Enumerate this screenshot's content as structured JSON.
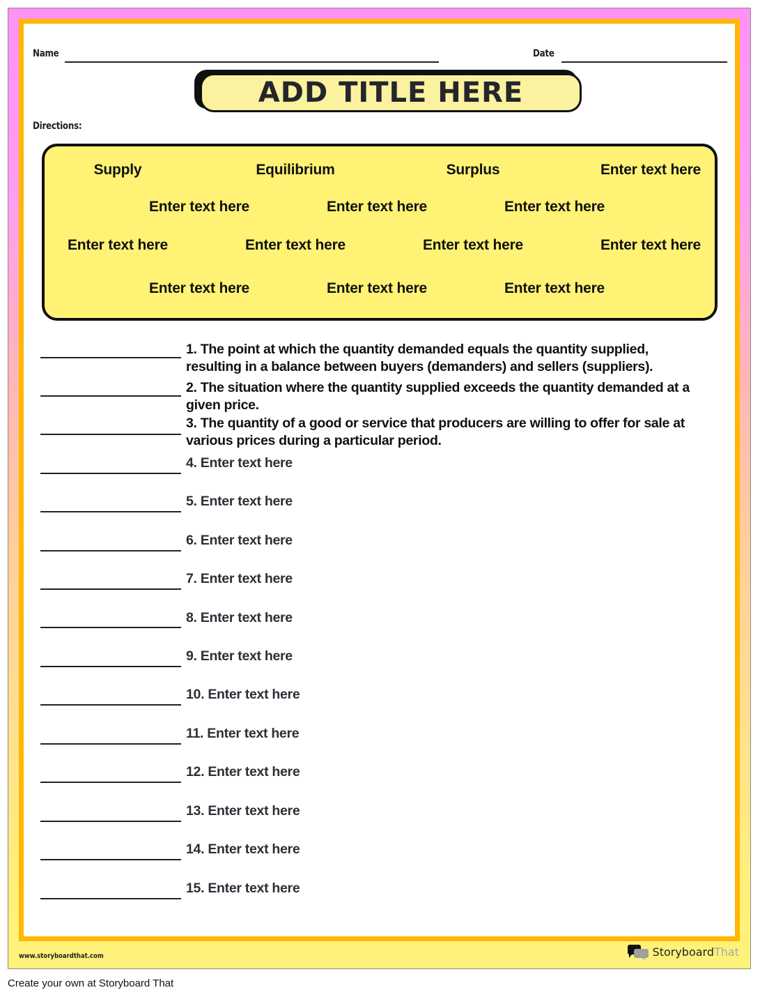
{
  "header": {
    "name_label": "Name",
    "date_label": "Date",
    "title": "ADD TITLE HERE",
    "directions_label": "Directions:"
  },
  "word_bank": {
    "rows": [
      [
        "Supply",
        "Equilibrium",
        "Surplus",
        "Enter text here"
      ],
      [
        "Enter text here",
        "Enter text here",
        "Enter text here"
      ],
      [
        "Enter text here",
        "Enter text here",
        "Enter text here",
        "Enter text here"
      ],
      [
        "Enter text here",
        "Enter text here",
        "Enter text here"
      ]
    ]
  },
  "questions": [
    {
      "number": "1.",
      "text": "The point at which the quantity demanded equals the quantity supplied, resulting in a balance between buyers (demanders) and sellers (suppliers).",
      "placeholder": false
    },
    {
      "number": "2.",
      "text": "The situation where the quantity supplied exceeds the quantity demanded at a given price.",
      "placeholder": false
    },
    {
      "number": "3.",
      "text": "The quantity of a good or service that producers are willing to offer for sale at various prices during a particular period.",
      "placeholder": false
    },
    {
      "number": "4.",
      "text": "Enter text here",
      "placeholder": true
    },
    {
      "number": "5.",
      "text": "Enter text here",
      "placeholder": true
    },
    {
      "number": "6.",
      "text": "Enter text here",
      "placeholder": true
    },
    {
      "number": "7.",
      "text": "Enter text here",
      "placeholder": true
    },
    {
      "number": "8.",
      "text": "Enter text here",
      "placeholder": true
    },
    {
      "number": "9.",
      "text": "Enter text here",
      "placeholder": true
    },
    {
      "number": "10.",
      "text": "Enter text here",
      "placeholder": true
    },
    {
      "number": "11.",
      "text": "Enter text here",
      "placeholder": true
    },
    {
      "number": "12.",
      "text": "Enter text here",
      "placeholder": true
    },
    {
      "number": "13.",
      "text": "Enter text here",
      "placeholder": true
    },
    {
      "number": "14.",
      "text": "Enter text here",
      "placeholder": true
    },
    {
      "number": "15.",
      "text": "Enter text here",
      "placeholder": true
    }
  ],
  "footer": {
    "url": "www.storyboardthat.com",
    "brand_bold": "Storyboard",
    "brand_light": "That",
    "logo_icon": "speech-bubbles-icon",
    "caption": "Create your own at Storyboard That"
  },
  "colors": {
    "outer_gradient_top": "#ff91f7",
    "outer_gradient_bottom": "#fff27a",
    "frame_border": "#ffb700",
    "word_bank_fill": "#fff275",
    "title_fill": "#faf29e"
  }
}
